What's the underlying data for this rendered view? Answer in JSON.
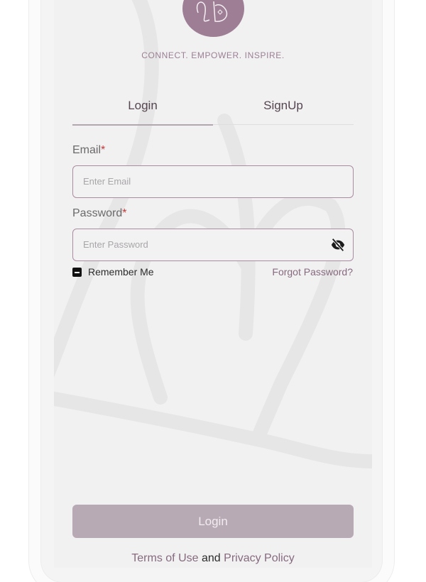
{
  "app": {
    "tagline": "CONNECT. EMPOWER. INSPIRE.",
    "logo_text": "LD"
  },
  "tabs": {
    "login": "Login",
    "signup": "SignUp",
    "active": "Login"
  },
  "form": {
    "email_label": "Email",
    "email_placeholder": "Enter Email",
    "password_label": "Password",
    "password_placeholder": "Enter Password",
    "required_mark": "*",
    "remember_label": "Remember Me",
    "remember_checked": true,
    "forgot_label": "Forgot Password?"
  },
  "actions": {
    "login_button": "Login"
  },
  "footer": {
    "terms": "Terms of Use",
    "and": "and",
    "privacy": "Privacy Policy"
  },
  "colors": {
    "brand": "#9d7e95",
    "accent_text": "#866a7e",
    "button_disabled": "#b8aab5",
    "required": "#c23a3a"
  },
  "icons": {
    "password_toggle": "eye-off-icon",
    "remember_checkbox": "checkbox-indeterminate-icon"
  }
}
